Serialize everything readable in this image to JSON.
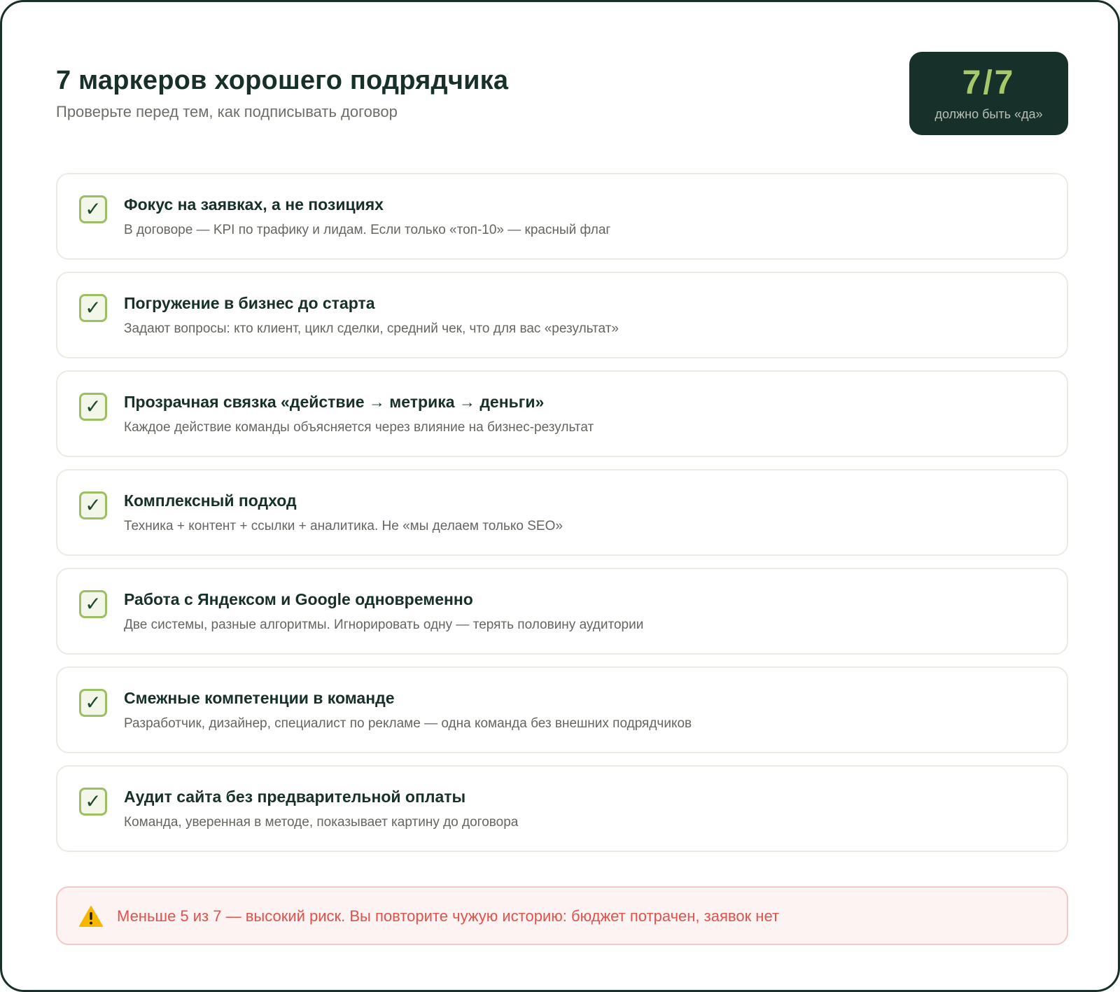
{
  "header": {
    "title": "7 маркеров хорошего подрядчика",
    "subtitle": "Проверьте перед тем, как подписывать договор"
  },
  "score": {
    "value": "7/7",
    "caption": "должно быть «да»"
  },
  "check_symbol": "✓",
  "items": [
    {
      "title": "Фокус на заявках, а не позициях",
      "description": "В договоре — KPI по трафику и лидам. Если только «топ-10» — красный флаг"
    },
    {
      "title": "Погружение в бизнес до старта",
      "description": "Задают вопросы: кто клиент, цикл сделки, средний чек, что для вас «результат»"
    },
    {
      "title": "Прозрачная связка «действие → метрика → деньги»",
      "description": "Каждое действие команды объясняется через влияние на бизнес-результат"
    },
    {
      "title": "Комплексный подход",
      "description": "Техника + контент + ссылки + аналитика. Не «мы делаем только SEO»"
    },
    {
      "title": "Работа с Яндексом и Google одновременно",
      "description": "Две системы, разные алгоритмы. Игнорировать одну — терять половину аудитории"
    },
    {
      "title": "Смежные компетенции в команде",
      "description": "Разработчик, дизайнер, специалист по рекламе — одна команда без внешних подрядчиков"
    },
    {
      "title": "Аудит сайта без предварительной оплаты",
      "description": "Команда, уверенная в методе, показывает картину до договора"
    }
  ],
  "warning": {
    "icon": "warning-icon",
    "text": "Меньше 5 из 7 — высокий риск. Вы повторите чужую историю: бюджет потрачен, заявок нет"
  },
  "colors": {
    "dark": "#17302a",
    "accent_green": "#a6c86b",
    "check_border": "#9cbf63",
    "warning_text": "#e0524c",
    "warning_bg": "#fdf3f2",
    "warning_icon": "#f5b700"
  }
}
